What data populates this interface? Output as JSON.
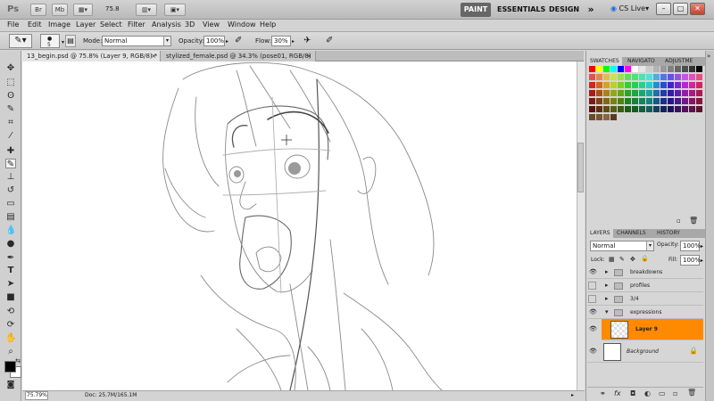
{
  "app": {
    "logo": "Ps",
    "bar_buttons": [
      "Br",
      "Mb"
    ],
    "zoom_level": "75.8",
    "workspaces": [
      "PAINT",
      "ESSENTIALS",
      "DESIGN"
    ],
    "workspace_more": "»",
    "cs_live": "CS Live",
    "window_buttons": [
      "–",
      "□",
      "✕"
    ]
  },
  "menu": [
    "File",
    "Edit",
    "Image",
    "Layer",
    "Select",
    "Filter",
    "Analysis",
    "3D",
    "View",
    "Window",
    "Help"
  ],
  "options": {
    "brush_size": "5",
    "mode_label": "Mode:",
    "mode_value": "Normal",
    "opacity_label": "Opacity:",
    "opacity_value": "100%",
    "flow_label": "Flow:",
    "flow_value": "30%"
  },
  "tabs": [
    {
      "label": "13_begin.psd @ 75.8% (Layer 9, RGB/8) *",
      "close": "×"
    },
    {
      "label": "stylized_female.psd @ 34.3% (pose01, RGB/8)",
      "close": "×"
    }
  ],
  "status": {
    "zoom": "75.79%",
    "doc": "Doc: 25.7M/165.1M"
  },
  "swatches_panel": {
    "tabs": [
      "SWATCHES",
      "NAVIGATO",
      "ADJUSTME"
    ]
  },
  "layers_panel": {
    "tabs": [
      "LAYERS",
      "CHANNELS",
      "HISTORY"
    ],
    "blend_mode": "Normal",
    "opacity_label": "Opacity:",
    "opacity_value": "100%",
    "lock_label": "Lock:",
    "fill_label": "Fill:",
    "fill_value": "100%",
    "layers": [
      {
        "name": "breakdowns",
        "visible": true
      },
      {
        "name": "profiles",
        "visible": false
      },
      {
        "name": "3/4",
        "visible": false
      },
      {
        "name": "expressions",
        "visible": true
      },
      {
        "name": "Layer 9",
        "visible": true,
        "selected": true
      },
      {
        "name": "Background",
        "visible": true
      }
    ]
  },
  "colors": {
    "accent": "#ff8a00",
    "active_workspace": "#666666"
  }
}
